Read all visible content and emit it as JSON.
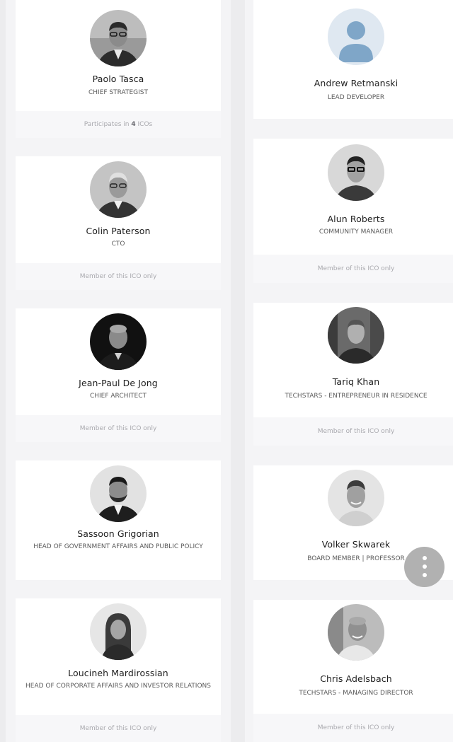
{
  "left_column": {
    "cards": [
      {
        "name": "Paolo Tasca",
        "role": "CHIEF STRATEGIST",
        "footer_prefix": "Participates in ",
        "footer_count": "4",
        "footer_suffix": " ICOs",
        "photo": "man-glasses-suit"
      },
      {
        "name": "Colin Paterson",
        "role": "CTO",
        "footer": "Member of this ICO only",
        "photo": "man-grey-hair-glasses"
      },
      {
        "name": "Jean-Paul De Jong",
        "role": "CHIEF ARCHITECT",
        "footer": "Member of this ICO only",
        "photo": "man-bald-dark-background"
      },
      {
        "name": "Sassoon Grigorian",
        "role": "HEAD OF GOVERNMENT AFFAIRS AND PUBLIC POLICY",
        "photo": "man-suit-beard"
      },
      {
        "name": "Loucineh Mardirossian",
        "role": "HEAD OF CORPORATE AFFAIRS AND INVESTOR RELATIONS",
        "footer": "Member of this ICO only",
        "photo": "woman-long-hair"
      }
    ]
  },
  "right_column": {
    "cards": [
      {
        "name": "Andrew Retmanski",
        "role": "LEAD DEVELOPER",
        "photo": "default-user-avatar"
      },
      {
        "name": "Alun Roberts",
        "role": "COMMUNITY MANAGER",
        "footer": "Member of this ICO only",
        "photo": "man-glasses-dark-hair"
      },
      {
        "name": "Tariq Khan",
        "role": "TECHSTARS - ENTREPRENEUR IN RESIDENCE",
        "footer": "Member of this ICO only",
        "photo": "man-office-background"
      },
      {
        "name": "Volker Skwarek",
        "role": "BOARD MEMBER | PROFESSOR",
        "photo": "man-smiling"
      },
      {
        "name": "Chris Adelsbach",
        "role": "TECHSTARS - MANAGING DIRECTOR",
        "footer": "Member of this ICO only",
        "photo": "man-smiling-outdoor"
      }
    ]
  },
  "fab": {
    "icon": "more-vertical-icon"
  },
  "colors": {
    "background": "#ececee",
    "card": "#ffffff",
    "footer": "#f7f7f9",
    "avatar_blue": "#7fa6c8",
    "avatar_bg": "#dfe8f1"
  }
}
